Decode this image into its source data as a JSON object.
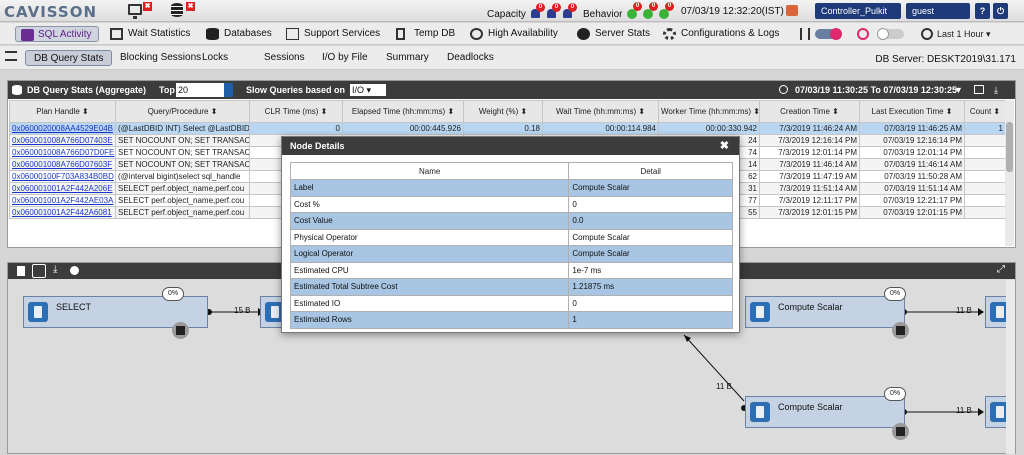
{
  "app": {
    "logo": "CAVISSON",
    "capacity_label": "Capacity",
    "behavior_label": "Behavior",
    "timestamp": "07/03/19 12:32:20(IST)",
    "controller": "Controller_Pulkit",
    "user": "guest",
    "help": "?",
    "power": "⏻",
    "badges": {
      "monitor_x": "✖",
      "db_x": "✖",
      "cap1": "0",
      "cap2": "0",
      "cap3": "0",
      "beh1": "0",
      "beh2": "0",
      "beh3": "0"
    }
  },
  "nav": {
    "items": [
      {
        "label": "SQL Activity"
      },
      {
        "label": "Wait Statistics"
      },
      {
        "label": "Databases"
      },
      {
        "label": "Support Services"
      },
      {
        "label": "Temp DB"
      },
      {
        "label": "High Availability"
      },
      {
        "label": "Server Stats"
      },
      {
        "label": "Configurations & Logs"
      }
    ],
    "time_range": "Last 1 Hour"
  },
  "subnav": {
    "tabs": [
      "DB Query Stats",
      "Blocking Sessions",
      "Locks",
      "Sessions",
      "I/O by File",
      "Summary",
      "Deadlocks"
    ],
    "db_server": "DB Server: DESKT2019\\31.171"
  },
  "panel": {
    "title": "DB Query Stats (Aggregate)",
    "top_label": "Top",
    "top_value": "20",
    "slow_label": "Slow Queries based on",
    "slow_value": "I/O",
    "range": "07/03/19 11:30:25 To 07/03/19 12:30:25",
    "columns": [
      "Plan Handle ⬍",
      "Query/Procedure ⬍",
      "CLR Time (ms) ⬍",
      "Elapsed Time (hh:mm:ms) ⬍",
      "Weight (%) ⬍",
      "Wait Time (hh:mm:ms) ⬍",
      "Worker Time (hh:mm:ms) ⬍",
      "Creation Time ⬍",
      "Last Execution Time ⬍",
      "Count ⬍"
    ],
    "rows": [
      [
        "0x0600020008AA4529E04B",
        "(@LastDBID INT) Select @LastDBID",
        "0",
        "00:00:445.926",
        "0.18",
        "00:00:114.984",
        "00:00:330.942",
        "7/3/2019 11:46:24 AM",
        "07/03/19 11:46:25 AM",
        "1"
      ],
      [
        "0x060001008A766D07403E",
        "SET NOCOUNT ON; SET TRANSACT",
        "",
        "",
        "",
        "",
        "24",
        "7/3/2019 12:16:14 PM",
        "07/03/19 12:16:14 PM",
        ""
      ],
      [
        "0x060001008A766D07D0FE",
        "SET NOCOUNT ON; SET TRANSACT",
        "",
        "",
        "",
        "",
        "74",
        "7/3/2019 12:01:14 PM",
        "07/03/19 12:01:14 PM",
        ""
      ],
      [
        "0x060001008A766D07603F",
        "SET NOCOUNT ON; SET TRANSACT",
        "",
        "",
        "",
        "",
        "14",
        "7/3/2019 11:46:14 AM",
        "07/03/19 11:46:14 AM",
        ""
      ],
      [
        "0x06000100F703A834B0BD",
        "(@interval bigint)select sql_handle",
        "",
        "",
        "",
        "",
        "62",
        "7/3/2019 11:47:19 AM",
        "07/03/19 11:50:28 AM",
        ""
      ],
      [
        "0x060001001A2F442A206E",
        "SELECT perf.object_name,perf.cou",
        "",
        "",
        "",
        "",
        "31",
        "7/3/2019 11:51:14 AM",
        "07/03/19 11:51:14 AM",
        ""
      ],
      [
        "0x060001001A2F442AE03A",
        "SELECT perf.object_name,perf.cou",
        "",
        "",
        "",
        "",
        "77",
        "7/3/2019 12:11:17 PM",
        "07/03/19 12:21:17 PM",
        ""
      ],
      [
        "0x060001001A2F442A6081",
        "SELECT perf.object_name,perf.cou",
        "",
        "",
        "",
        "",
        "55",
        "7/3/2019 12:01:15 PM",
        "07/03/19 12:01:15 PM",
        ""
      ]
    ]
  },
  "plan": {
    "nodes": [
      {
        "label": "SELECT",
        "pct": "0%"
      },
      {
        "label": "Compute Scalar",
        "pct": "0%"
      },
      {
        "label": "Compute Scalar",
        "pct": "0%"
      }
    ],
    "edges": [
      "15 B",
      "11 B",
      "11 B",
      "11 B"
    ]
  },
  "modal": {
    "title": "Node Details",
    "close": "✖",
    "col_name": "Name",
    "col_detail": "Detail",
    "rows": [
      [
        "Label",
        "Compute Scalar"
      ],
      [
        "Cost %",
        "0"
      ],
      [
        "Cost Value",
        "0.0"
      ],
      [
        "Physical Operator",
        "Compute Scalar"
      ],
      [
        "Logical Operator",
        "Compute Scalar"
      ],
      [
        "Estimated CPU",
        "1e-7 ms"
      ],
      [
        "Estimated Total Subtree Cost",
        "1.21875 ms"
      ],
      [
        "Estimated IO",
        "0"
      ],
      [
        "Estimated Rows",
        "1"
      ]
    ]
  }
}
